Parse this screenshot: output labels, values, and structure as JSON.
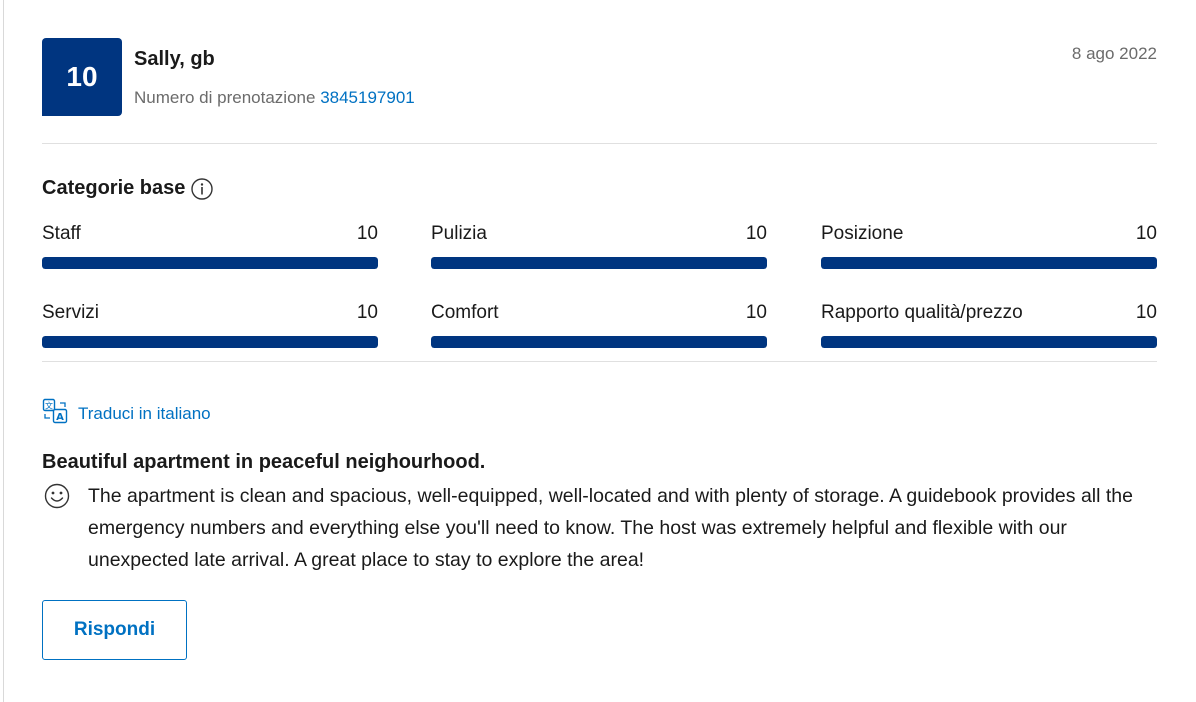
{
  "review": {
    "score": "10",
    "reviewer": "Sally, gb",
    "booking_label": "Numero di prenotazione",
    "booking_number": "3845197901",
    "date": "8 ago 2022"
  },
  "categories": {
    "heading": "Categorie base",
    "items": [
      {
        "label": "Staff",
        "value": "10",
        "fraction": 1.0
      },
      {
        "label": "Pulizia",
        "value": "10",
        "fraction": 1.0
      },
      {
        "label": "Posizione",
        "value": "10",
        "fraction": 1.0
      },
      {
        "label": "Servizi",
        "value": "10",
        "fraction": 1.0
      },
      {
        "label": "Comfort",
        "value": "10",
        "fraction": 1.0
      },
      {
        "label": "Rapporto qualità/prezzo",
        "value": "10",
        "fraction": 1.0
      }
    ]
  },
  "translate": {
    "label": "Traduci in italiano",
    "icon": "translate-icon"
  },
  "content": {
    "title": "Beautiful apartment in peaceful neighourhood.",
    "positive_icon": "smiley-icon",
    "body": "The apartment is clean and spacious, well-equipped, well-located and with plenty of storage. A guidebook provides all the emergency numbers and everything else you'll need to know. The host was extremely helpful and flexible with our unexpected late arrival. A great place to stay to explore the area!"
  },
  "actions": {
    "reply_label": "Rispondi"
  },
  "colors": {
    "score_bg": "#003580",
    "bar": "#003580",
    "link": "#0071c2"
  }
}
